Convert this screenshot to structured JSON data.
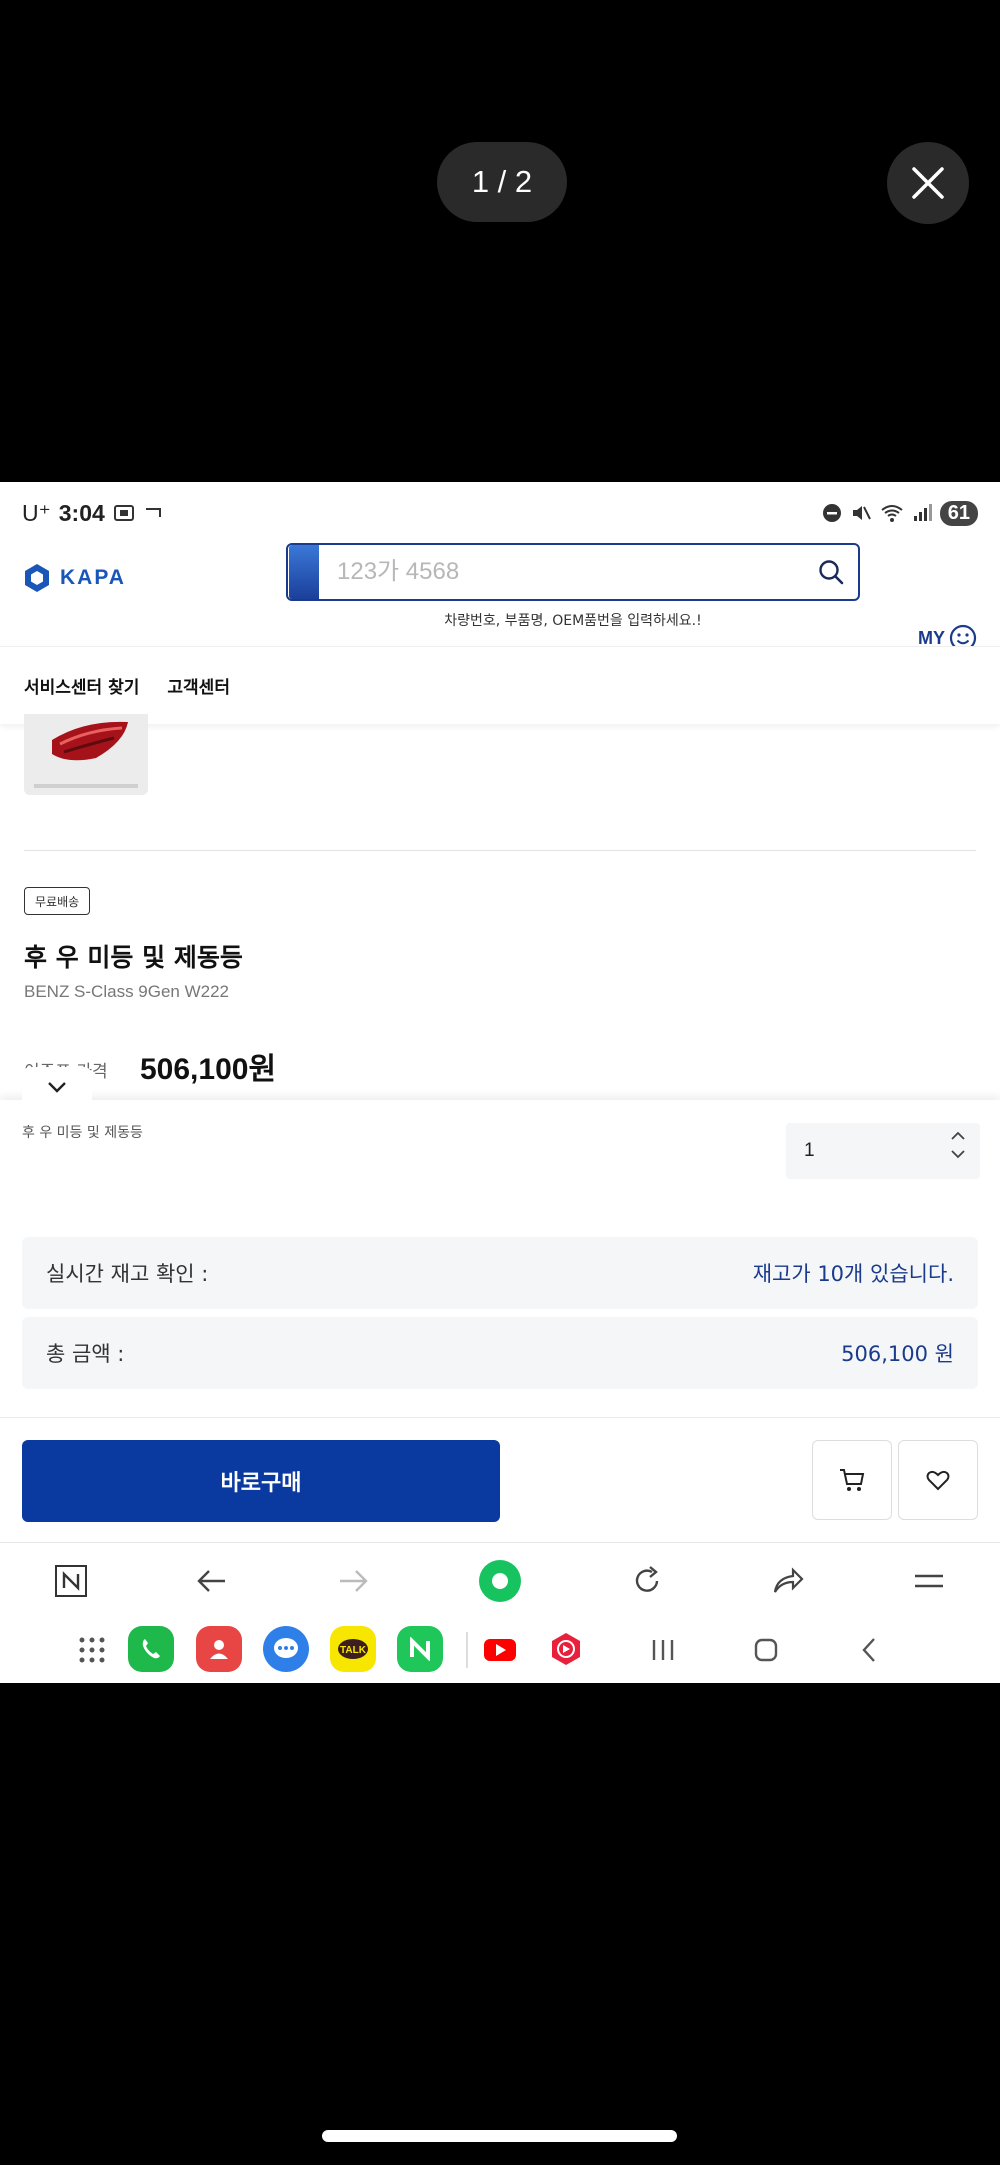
{
  "viewer": {
    "counter": "1 / 2"
  },
  "status_bar": {
    "carrier": "U⁺",
    "time": "3:04",
    "battery": "61"
  },
  "header": {
    "logo_text": "KAPA",
    "search_placeholder": "123가 4568",
    "search_hint": "차량번호, 부품명, OEM품번을 입력하세요.!",
    "my_label": "MY"
  },
  "nav": {
    "items": [
      "서비스센터 찾기",
      "고객센터"
    ]
  },
  "product": {
    "badge": "무료배송",
    "title": "후 우 미등 및 제동등",
    "subtitle": "BENZ S-Class 9Gen W222",
    "price_label": "이주프 가격",
    "price": "506,100원"
  },
  "option": {
    "name": "후 우 미등 및 제동등",
    "quantity": "1"
  },
  "summary": {
    "stock_label": "실시간 재고 확인 :",
    "stock_value": "재고가 10개 있습니다.",
    "total_label": "총 금액 :",
    "total_value": "506,100 원"
  },
  "actions": {
    "buy_label": "바로구매"
  },
  "browser": {
    "icons": [
      "naver-home-icon",
      "back-icon",
      "forward-icon",
      "green-dot-icon",
      "refresh-icon",
      "share-icon",
      "menu-icon"
    ]
  },
  "colors": {
    "primary": "#0a3aa0",
    "accent_text": "#1a3b8c"
  }
}
